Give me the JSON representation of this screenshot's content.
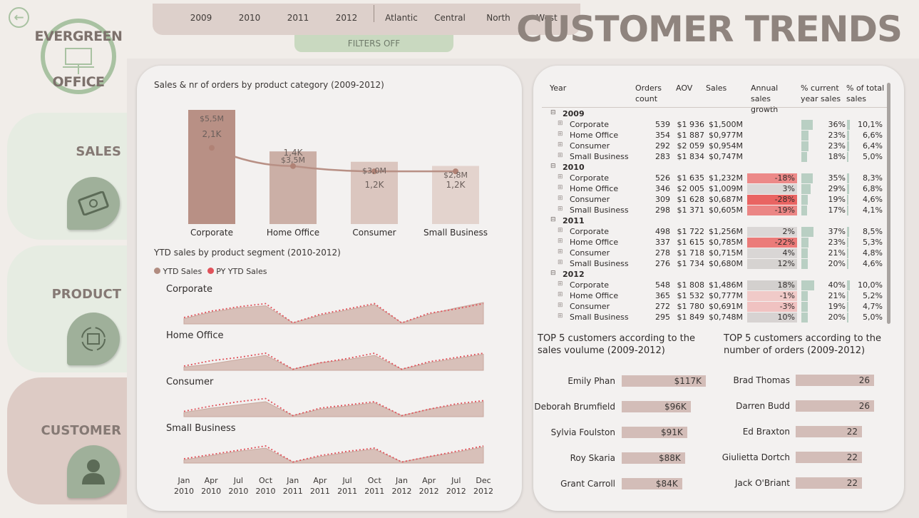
{
  "header": {
    "title": "CUSTOMER TRENDS",
    "back_icon": "arrow-left-icon",
    "filters_off": "FILTERS OFF"
  },
  "logo": {
    "line1": "EVERGREEN",
    "line2": "OFFICE"
  },
  "filters": {
    "years": [
      "2009",
      "2010",
      "2011",
      "2012"
    ],
    "regions": [
      "Atlantic",
      "Central",
      "North",
      "West"
    ]
  },
  "nav": [
    {
      "label": "SALES",
      "icon": "money-icon"
    },
    {
      "label": "PRODUCT",
      "icon": "box-cycle-icon"
    },
    {
      "label": "CUSTOMER",
      "icon": "person-icon",
      "active": true
    }
  ],
  "colors": {
    "accent": "#b18c80",
    "py": "#e0525a",
    "green": "#9fb09a",
    "neg": "#e97a78"
  },
  "category_chart": {
    "title": "Sales & nr of orders by product category (2009-2012)",
    "chart_data": {
      "type": "bar",
      "categories": [
        "Corporate",
        "Home Office",
        "Consumer",
        "Small Business"
      ],
      "series": [
        {
          "name": "Sales",
          "values": [
            5.5,
            3.5,
            3.0,
            2.8
          ],
          "labels": [
            "$5,5M",
            "$3,5M",
            "$3,0M",
            "$2,8M"
          ]
        },
        {
          "name": "Orders",
          "values": [
            2.1,
            1.4,
            1.2,
            1.2
          ],
          "labels": [
            "2,1K",
            "1,4K",
            "1,2K",
            "1,2K"
          ]
        }
      ]
    }
  },
  "ytd_chart": {
    "title": "YTD sales by product segment (2010-2012)",
    "legend": [
      "YTD Sales",
      "PY YTD Sales"
    ],
    "segments": [
      {
        "name": "Corporate",
        "ytd": [
          0.25,
          0.55,
          0.75,
          0.85,
          0.05,
          0.4,
          0.65,
          0.9,
          0.05,
          0.45,
          0.75,
          1.0
        ],
        "py": [
          0.3,
          0.6,
          0.8,
          0.95,
          0.05,
          0.45,
          0.7,
          0.95,
          0.05,
          0.5,
          0.7,
          0.95
        ]
      },
      {
        "name": "Home Office",
        "ytd": [
          0.15,
          0.3,
          0.5,
          0.7,
          0.05,
          0.35,
          0.5,
          0.7,
          0.05,
          0.35,
          0.55,
          0.75
        ],
        "py": [
          0.2,
          0.45,
          0.6,
          0.8,
          0.05,
          0.35,
          0.55,
          0.8,
          0.05,
          0.4,
          0.6,
          0.8
        ]
      },
      {
        "name": "Consumer",
        "ytd": [
          0.2,
          0.4,
          0.55,
          0.7,
          0.05,
          0.35,
          0.5,
          0.65,
          0.05,
          0.35,
          0.55,
          0.7
        ],
        "py": [
          0.25,
          0.5,
          0.7,
          0.85,
          0.05,
          0.4,
          0.55,
          0.7,
          0.05,
          0.35,
          0.6,
          0.75
        ]
      },
      {
        "name": "Small Business",
        "ytd": [
          0.15,
          0.35,
          0.55,
          0.7,
          0.05,
          0.3,
          0.5,
          0.65,
          0.05,
          0.3,
          0.5,
          0.75
        ],
        "py": [
          0.2,
          0.4,
          0.6,
          0.8,
          0.05,
          0.35,
          0.55,
          0.7,
          0.05,
          0.3,
          0.55,
          0.8
        ]
      }
    ],
    "months": [
      [
        "Jan",
        "2010"
      ],
      [
        "Apr",
        "2010"
      ],
      [
        "Jul",
        "2010"
      ],
      [
        "Oct",
        "2010"
      ],
      [
        "Jan",
        "2011"
      ],
      [
        "Apr",
        "2011"
      ],
      [
        "Jul",
        "2011"
      ],
      [
        "Oct",
        "2011"
      ],
      [
        "Jan",
        "2012"
      ],
      [
        "Apr",
        "2012"
      ],
      [
        "Jul",
        "2012"
      ],
      [
        "Dec",
        "2012"
      ]
    ]
  },
  "table": {
    "headers": [
      "Year",
      "Orders count",
      "AOV",
      "Sales",
      "Annual sales growth",
      "% current year sales",
      "% of total sales"
    ],
    "years": [
      {
        "year": "2009",
        "rows": [
          {
            "seg": "Corporate",
            "orders": "539",
            "aov": "$1 936",
            "sales": "$1,500M",
            "growth": "",
            "g": 0,
            "cy": "36%",
            "cyv": 36,
            "tot": "10,1%",
            "totv": 10.1
          },
          {
            "seg": "Home Office",
            "orders": "354",
            "aov": "$1 887",
            "sales": "$0,977M",
            "growth": "",
            "g": 0,
            "cy": "23%",
            "cyv": 23,
            "tot": "6,6%",
            "totv": 6.6
          },
          {
            "seg": "Consumer",
            "orders": "292",
            "aov": "$2 059",
            "sales": "$0,954M",
            "growth": "",
            "g": 0,
            "cy": "23%",
            "cyv": 23,
            "tot": "6,4%",
            "totv": 6.4
          },
          {
            "seg": "Small Business",
            "orders": "283",
            "aov": "$1 834",
            "sales": "$0,747M",
            "growth": "",
            "g": 0,
            "cy": "18%",
            "cyv": 18,
            "tot": "5,0%",
            "totv": 5.0
          }
        ]
      },
      {
        "year": "2010",
        "rows": [
          {
            "seg": "Corporate",
            "orders": "526",
            "aov": "$1 635",
            "sales": "$1,232M",
            "growth": "-18%",
            "g": -18,
            "cy": "35%",
            "cyv": 35,
            "tot": "8,3%",
            "totv": 8.3
          },
          {
            "seg": "Home Office",
            "orders": "346",
            "aov": "$2 005",
            "sales": "$1,009M",
            "growth": "3%",
            "g": 3,
            "cy": "29%",
            "cyv": 29,
            "tot": "6,8%",
            "totv": 6.8
          },
          {
            "seg": "Consumer",
            "orders": "309",
            "aov": "$1 628",
            "sales": "$0,687M",
            "growth": "-28%",
            "g": -28,
            "cy": "19%",
            "cyv": 19,
            "tot": "4,6%",
            "totv": 4.6
          },
          {
            "seg": "Small Business",
            "orders": "298",
            "aov": "$1 371",
            "sales": "$0,605M",
            "growth": "-19%",
            "g": -19,
            "cy": "17%",
            "cyv": 17,
            "tot": "4,1%",
            "totv": 4.1
          }
        ]
      },
      {
        "year": "2011",
        "rows": [
          {
            "seg": "Corporate",
            "orders": "498",
            "aov": "$1 722",
            "sales": "$1,256M",
            "growth": "2%",
            "g": 2,
            "cy": "37%",
            "cyv": 37,
            "tot": "8,5%",
            "totv": 8.5
          },
          {
            "seg": "Home Office",
            "orders": "337",
            "aov": "$1 615",
            "sales": "$0,785M",
            "growth": "-22%",
            "g": -22,
            "cy": "23%",
            "cyv": 23,
            "tot": "5,3%",
            "totv": 5.3
          },
          {
            "seg": "Consumer",
            "orders": "278",
            "aov": "$1 718",
            "sales": "$0,715M",
            "growth": "4%",
            "g": 4,
            "cy": "21%",
            "cyv": 21,
            "tot": "4,8%",
            "totv": 4.8
          },
          {
            "seg": "Small Business",
            "orders": "276",
            "aov": "$1 734",
            "sales": "$0,680M",
            "growth": "12%",
            "g": 12,
            "cy": "20%",
            "cyv": 20,
            "tot": "4,6%",
            "totv": 4.6
          }
        ]
      },
      {
        "year": "2012",
        "rows": [
          {
            "seg": "Corporate",
            "orders": "548",
            "aov": "$1 808",
            "sales": "$1,486M",
            "growth": "18%",
            "g": 18,
            "cy": "40%",
            "cyv": 40,
            "tot": "10,0%",
            "totv": 10.0
          },
          {
            "seg": "Home Office",
            "orders": "365",
            "aov": "$1 532",
            "sales": "$0,777M",
            "growth": "-1%",
            "g": -1,
            "cy": "21%",
            "cyv": 21,
            "tot": "5,2%",
            "totv": 5.2
          },
          {
            "seg": "Consumer",
            "orders": "272",
            "aov": "$1 780",
            "sales": "$0,691M",
            "growth": "-3%",
            "g": -3,
            "cy": "19%",
            "cyv": 19,
            "tot": "4,7%",
            "totv": 4.7
          },
          {
            "seg": "Small Business",
            "orders": "295",
            "aov": "$1 849",
            "sales": "$0,748M",
            "growth": "10%",
            "g": 10,
            "cy": "20%",
            "cyv": 20,
            "tot": "5,0%",
            "totv": 5.0
          }
        ]
      }
    ]
  },
  "top_sales": {
    "title": "TOP 5 customers according to the sales voulume (2009-2012)",
    "chart_data": {
      "type": "bar",
      "categories": [
        "Emily Phan",
        "Deborah Brumfield",
        "Sylvia Foulston",
        "Roy Skaria",
        "Grant Carroll"
      ],
      "values": [
        117,
        96,
        91,
        88,
        84
      ],
      "labels": [
        "$117K",
        "$96K",
        "$91K",
        "$88K",
        "$84K"
      ]
    }
  },
  "top_orders": {
    "title": "TOP 5 customers according to the number of orders (2009-2012)",
    "chart_data": {
      "type": "bar",
      "categories": [
        "Brad Thomas",
        "Darren Budd",
        "Ed Braxton",
        "Giulietta Dortch",
        "Jack O'Briant"
      ],
      "values": [
        26,
        26,
        22,
        22,
        22
      ],
      "labels": [
        "26",
        "26",
        "22",
        "22",
        "22"
      ]
    }
  }
}
